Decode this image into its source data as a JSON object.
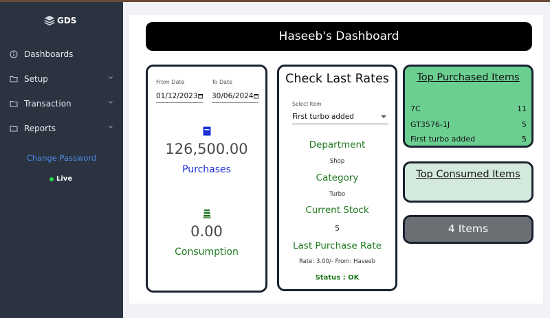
{
  "brand": {
    "name": "GDS",
    "logo_icon": "layers-icon"
  },
  "sidebar": {
    "items": [
      {
        "label": "Dashboards",
        "icon": "info-circle-icon",
        "has_chevron": false
      },
      {
        "label": "Setup",
        "icon": "folder-icon",
        "has_chevron": true
      },
      {
        "label": "Transaction",
        "icon": "folder-icon",
        "has_chevron": true
      },
      {
        "label": "Reports",
        "icon": "folder-icon",
        "has_chevron": true
      }
    ],
    "change_password": "Change Password",
    "status": "Live",
    "status_color": "#26d94a"
  },
  "header": {
    "title": "Haseeb's Dashboard"
  },
  "summary": {
    "from_date_label": "From Date",
    "from_date_value": "01/12/2023",
    "to_date_label": "To Date",
    "to_date_value": "30/06/2024",
    "purchases_value": "126,500.00",
    "purchases_label": "Purchases",
    "purchases_color": "#1a2fd6",
    "consumption_value": "0.00",
    "consumption_label": "Consumption",
    "consumption_color": "#1f7a1f"
  },
  "rates": {
    "title": "Check Last Rates",
    "select_label": "Select Item",
    "selected_item": "First turbo added",
    "department_label": "Department",
    "department_value": "Shop",
    "category_label": "Category",
    "category_value": "Turbo",
    "stock_label": "Current Stock",
    "stock_value": "5",
    "last_rate_label": "Last Purchase Rate",
    "last_rate_value": "Rate: 3.00/- From: Haseeb",
    "status": "Status : OK"
  },
  "top_purchased": {
    "title": "Top Purchased Items",
    "rows": [
      {
        "name": "7C",
        "qty": "11"
      },
      {
        "name": "GT3576-1J",
        "qty": "5"
      },
      {
        "name": "First turbo added",
        "qty": "5"
      }
    ]
  },
  "top_consumed": {
    "title": "Top Consumed Items"
  },
  "items_count": {
    "label": "4 Items"
  }
}
